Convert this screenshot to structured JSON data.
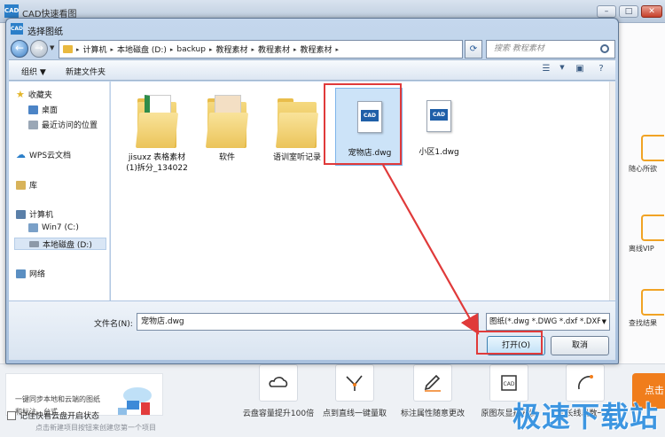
{
  "app": {
    "title": "CAD快速看图",
    "logo_text": "CAD",
    "right_panel": [
      "随心所欲",
      "离线VIP",
      "查找结果"
    ],
    "promo_text": "一键同步本地和云端的图纸和标注，台式",
    "remember_label": "记住快看云盘开启状态",
    "hint": "点击新建项目按钮来创建您第一个项目",
    "features": [
      "云盘容量提升100倍",
      "点到直线一键量取",
      "标注属性随意更改",
      "原图灰显最方便",
      "加长线段数一键"
    ],
    "open_pill": "点击",
    "watermark": "极速下载站"
  },
  "dialog": {
    "title": "选择图纸",
    "icon_text": "CAD",
    "breadcrumb": [
      "计算机",
      "本地磁盘 (D:)",
      "backup",
      "教程素材",
      "教程素材",
      "教程素材"
    ],
    "search_placeholder": "搜索 教程素材",
    "toolbar": {
      "organize": "组织 ▼",
      "new_folder": "新建文件夹"
    },
    "sidebar": {
      "favorites": "收藏夹",
      "desktop": "桌面",
      "recent": "最近访问的位置",
      "wps": "WPS云文档",
      "library": "库",
      "computer": "计算机",
      "win7": "Win7 (C:)",
      "local_d": "本地磁盘 (D:)",
      "network": "网络"
    },
    "files": [
      {
        "label": "jisuxz 表格素材(1)拆分_134022",
        "kind": "folder-excel"
      },
      {
        "label": "软件",
        "kind": "folder-doc"
      },
      {
        "label": "语训室听记录",
        "kind": "folder"
      },
      {
        "label": "宠物店.dwg",
        "kind": "dwg"
      },
      {
        "label": "小区1.dwg",
        "kind": "dwg"
      }
    ],
    "filename_label": "文件名(N):",
    "filename_value": "宠物店.dwg",
    "filter_value": "图纸(*.dwg *.DWG *.dxf *.DXF",
    "open_button": "打开(O)",
    "cancel_button": "取消"
  },
  "colors": {
    "highlight": "#e03a3a",
    "accent": "#2b7fc9"
  }
}
